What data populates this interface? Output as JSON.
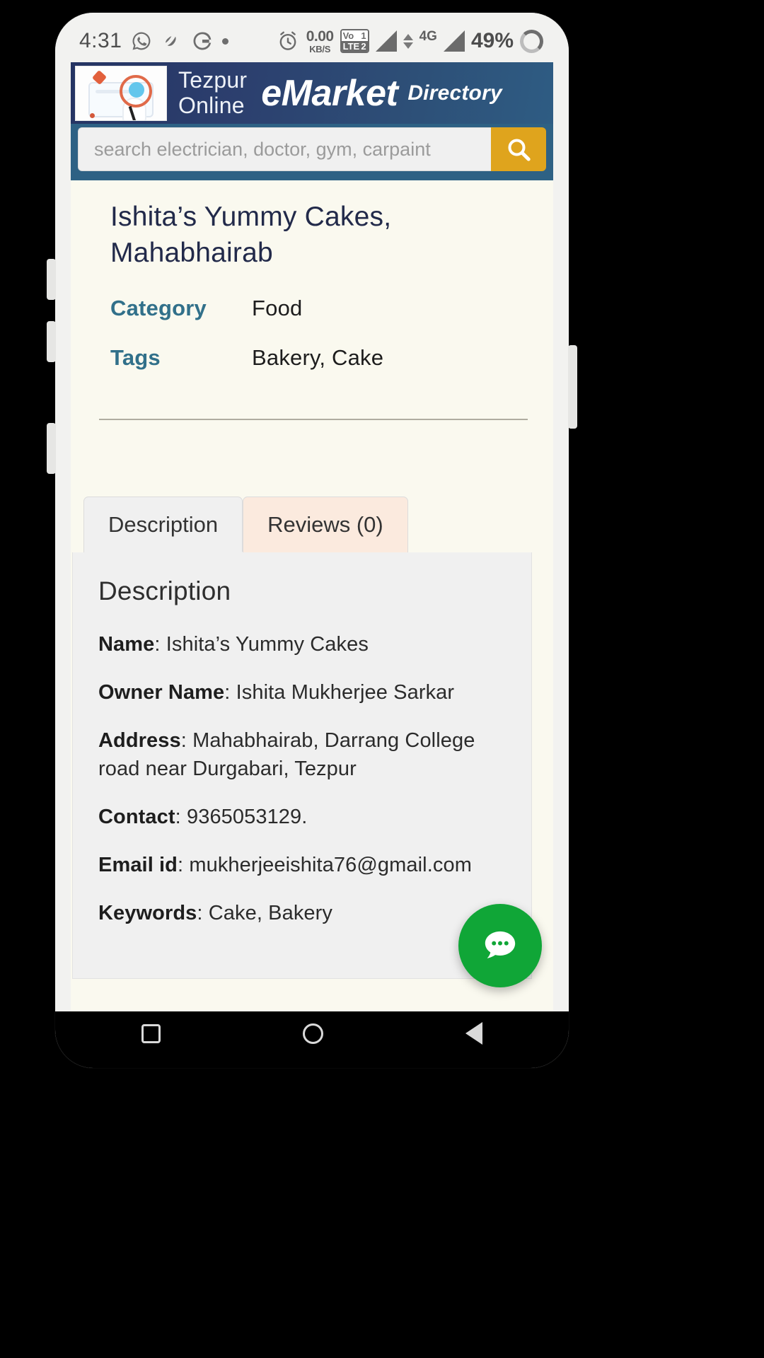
{
  "status_bar": {
    "clock": "4:31",
    "icons": [
      "whatsapp-icon",
      "app-icon",
      "google-icon",
      "notification-dot"
    ],
    "alarm_icon": "alarm-icon",
    "net_speed_value": "0.00",
    "net_speed_unit": "KB/S",
    "volte_badge": {
      "line1_left": "Vo",
      "line1_right": "1",
      "line2_left": "LTE",
      "line2_right": "2"
    },
    "network_generation": "4G",
    "battery_percent": "49%"
  },
  "header": {
    "logo_name": "tezpur-online-logo",
    "brand_line1": "Tezpur",
    "brand_line2": "Online",
    "brand_emphasis": "eMarket",
    "brand_suffix": "Directory",
    "colors": {
      "header_start": "#253463",
      "header_end": "#2e5c83"
    }
  },
  "search": {
    "placeholder": "search electrician, doctor, gym, carpaint",
    "value": "",
    "button_icon": "search-icon",
    "button_color": "#dfa41d",
    "bar_background": "#2e6184"
  },
  "listing": {
    "title": "Ishita’s Yummy Cakes, Mahabhairab",
    "fields": [
      {
        "label": "Category",
        "value": "Food"
      },
      {
        "label": "Tags",
        "value": "Bakery, Cake"
      }
    ],
    "label_color": "#31708a"
  },
  "tabs": {
    "items": [
      {
        "label": "Description",
        "active": true
      },
      {
        "label": "Reviews (0)",
        "active": false
      }
    ],
    "active_bg": "#f0f0f0",
    "inactive_bg": "#fbeade"
  },
  "description_panel": {
    "heading": "Description",
    "lines": [
      {
        "label": "Name",
        "value": "Ishita’s Yummy Cakes"
      },
      {
        "label": "Owner Name",
        "value": "Ishita Mukherjee Sarkar"
      },
      {
        "label": "Address",
        "value": "Mahabhairab, Darrang College road  near Durgabari, Tezpur"
      },
      {
        "label": "Contact",
        "value": "9365053129."
      },
      {
        "label": "Email id",
        "value": "mukherjeeishita76@gmail.com"
      },
      {
        "label": "Keywords",
        "value": "Cake, Bakery"
      }
    ]
  },
  "chat_fab": {
    "icon": "chat-bubble-icon",
    "color": "#10a637"
  },
  "nav_bar": {
    "items": [
      {
        "name": "recents-button",
        "icon": "square-icon"
      },
      {
        "name": "home-button",
        "icon": "circle-icon"
      },
      {
        "name": "back-button",
        "icon": "triangle-left-icon"
      }
    ]
  }
}
